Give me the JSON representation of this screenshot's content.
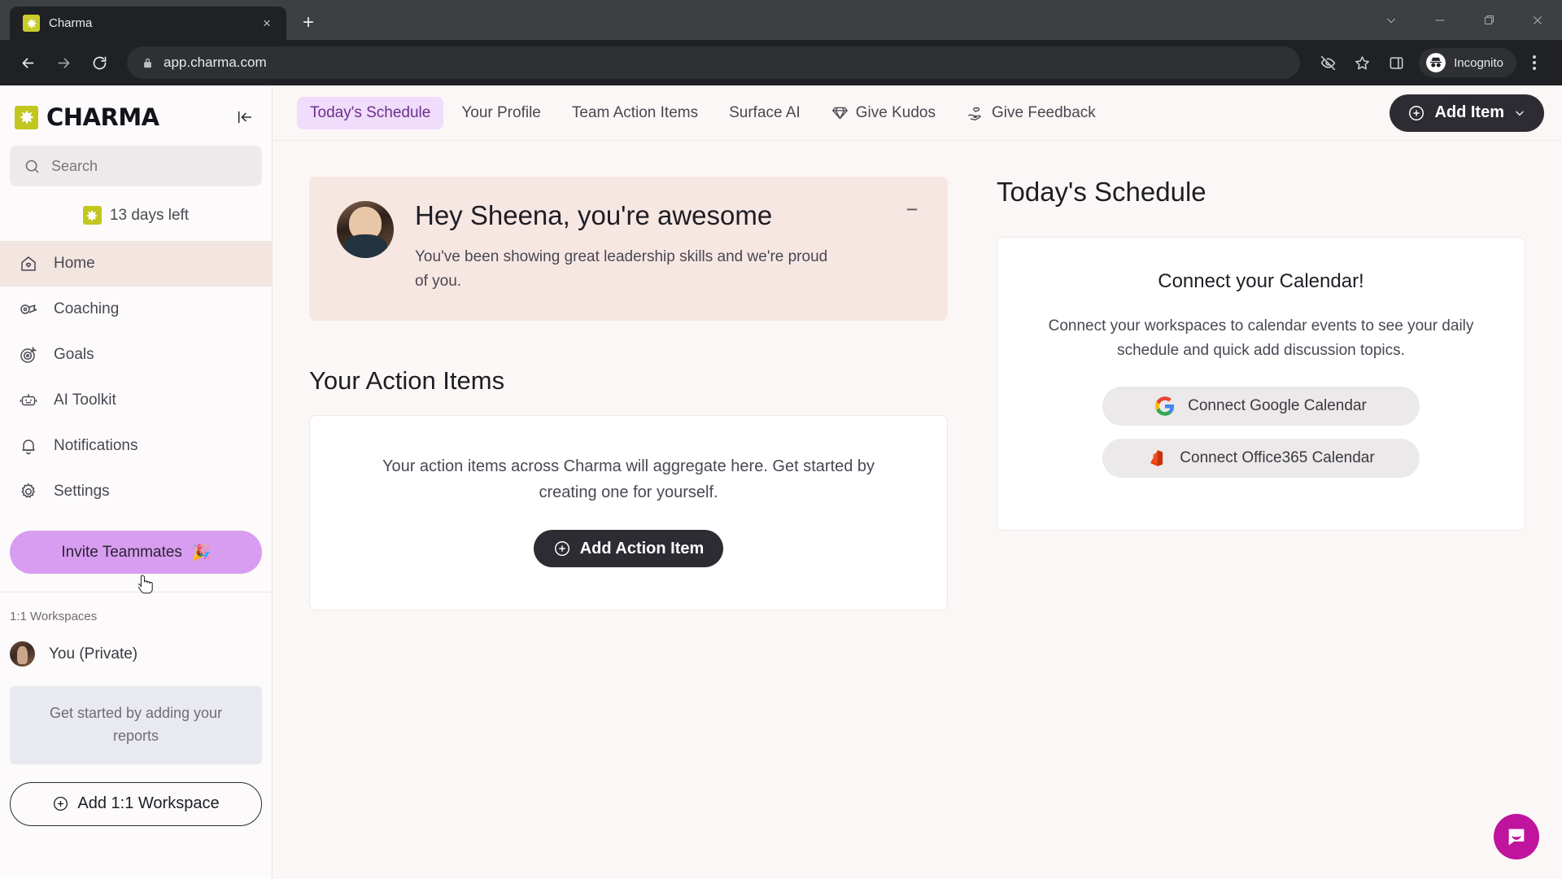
{
  "browser": {
    "tab": {
      "title": "Charma",
      "favicon": "charma-star-icon",
      "close_label": "×"
    },
    "new_tab_label": "+",
    "window_controls": [
      "chevron-down-icon",
      "minimize-icon",
      "maximize-icon",
      "close-icon"
    ],
    "nav": {
      "back": "back-icon",
      "forward": "forward-icon",
      "reload": "reload-icon"
    },
    "omnibox": {
      "lock": "lock-icon",
      "url": "app.charma.com"
    },
    "toolbar_icons": [
      "eye-slash-icon",
      "bookmark-star-icon",
      "side-panel-icon"
    ],
    "incognito": {
      "label": "Incognito",
      "icon": "incognito-hat-icon"
    },
    "menu": "three-dot-menu-icon"
  },
  "sidebar": {
    "logo_text": "CHARMA",
    "collapse_icon": "collapse-sidebar-icon",
    "search": {
      "placeholder": "Search",
      "value": "",
      "icon": "search-icon"
    },
    "trial": {
      "text": "13 days left",
      "badge_icon": "charma-star-icon"
    },
    "nav_items": [
      {
        "label": "Home",
        "icon": "home-heart-icon",
        "active": true
      },
      {
        "label": "Coaching",
        "icon": "whistle-icon",
        "active": false
      },
      {
        "label": "Goals",
        "icon": "target-icon",
        "active": false
      },
      {
        "label": "AI Toolkit",
        "icon": "robot-icon",
        "active": false
      },
      {
        "label": "Notifications",
        "icon": "bell-icon",
        "active": false
      },
      {
        "label": "Settings",
        "icon": "gear-icon",
        "active": false
      }
    ],
    "invite_button": {
      "label": "Invite Teammates",
      "emoji": "🎉"
    },
    "workspaces_label": "1:1 Workspaces",
    "workspace_rows": [
      {
        "label": "You (Private)",
        "avatar": "user-avatar"
      }
    ],
    "workspaces_empty": "Get started by adding your reports",
    "add_workspace_button": {
      "label": "Add 1:1 Workspace",
      "icon": "plus-circle-icon"
    }
  },
  "topnav": {
    "tabs": [
      {
        "label": "Today's Schedule",
        "icon": "",
        "active": true
      },
      {
        "label": "Your Profile",
        "icon": "",
        "active": false
      },
      {
        "label": "Team Action Items",
        "icon": "",
        "active": false
      },
      {
        "label": "Surface AI",
        "icon": "",
        "active": false
      },
      {
        "label": "Give Kudos",
        "icon": "gem-icon",
        "active": false
      },
      {
        "label": "Give Feedback",
        "icon": "heart-hand-icon",
        "active": false
      }
    ],
    "add_item_button": {
      "label": "Add Item",
      "icon": "plus-circle-icon",
      "chevron": "chevron-down-icon"
    }
  },
  "main": {
    "greeting": {
      "title": "Hey Sheena, you're awesome",
      "body": "You've been showing great leadership skills and we're proud of you.",
      "minimize_label": "−",
      "avatar": "sheena-avatar"
    },
    "action_items": {
      "section_title": "Your Action Items",
      "empty_text": "Your action items across Charma will aggregate here. Get started by creating one for yourself.",
      "button": {
        "label": "Add Action Item",
        "icon": "plus-circle-icon"
      }
    }
  },
  "schedule": {
    "title": "Today's Schedule",
    "card": {
      "heading": "Connect your Calendar!",
      "description": "Connect your workspaces to calendar events to see your daily schedule and quick add discussion topics.",
      "buttons": [
        {
          "label": "Connect Google Calendar",
          "icon": "google-logo-icon"
        },
        {
          "label": "Connect Office365 Calendar",
          "icon": "office365-logo-icon"
        }
      ]
    }
  },
  "support": {
    "launcher_icon": "intercom-chat-icon"
  },
  "colors": {
    "accent_purple": "#d89df0",
    "active_tab_bg": "#f0dcfb",
    "active_tab_text": "#6b2f8c",
    "brand_olive": "#c2c71f",
    "page_bg": "#fbf7f6",
    "greeting_bg": "#f6e7e3",
    "dark_button": "#2e2c33",
    "intercom": "#c0149e"
  }
}
